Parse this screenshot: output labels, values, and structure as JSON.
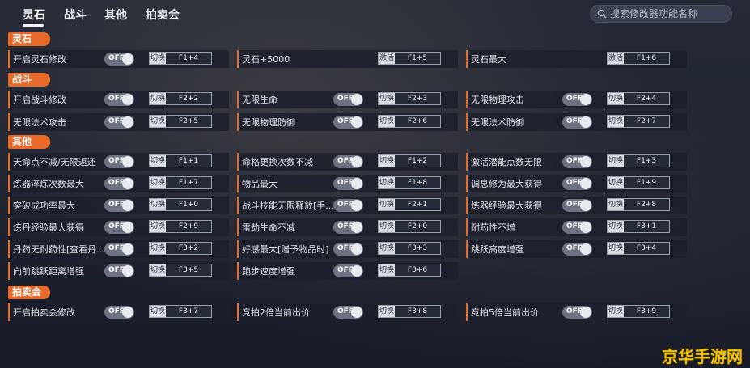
{
  "tabs": [
    {
      "label": "灵石"
    },
    {
      "label": "战斗"
    },
    {
      "label": "其他"
    },
    {
      "label": "拍卖会"
    }
  ],
  "search": {
    "placeholder": "搜索修改器功能名称"
  },
  "sections": [
    {
      "title": "灵石"
    },
    {
      "title": "战斗"
    },
    {
      "title": "其他"
    },
    {
      "title": "拍卖会"
    }
  ],
  "toggle_off_label": "OFF",
  "rows": [
    {
      "label": "开启灵石修改",
      "action": "切换",
      "key": "F1+4",
      "toggle": true
    },
    {
      "label": "灵石+5000",
      "action": "激活",
      "key": "F1+5",
      "toggle": false
    },
    {
      "label": "灵石最大",
      "action": "激活",
      "key": "F1+6",
      "toggle": false
    },
    {
      "label": "开启战斗修改",
      "action": "切换",
      "key": "F2+2",
      "toggle": true
    },
    {
      "label": "无限生命",
      "action": "切换",
      "key": "F2+3",
      "toggle": true
    },
    {
      "label": "无限物理攻击",
      "action": "切换",
      "key": "F2+4",
      "toggle": true
    },
    {
      "label": "无限法术攻击",
      "action": "切换",
      "key": "F2+5",
      "toggle": true
    },
    {
      "label": "无限物理防御",
      "action": "切换",
      "key": "F2+6",
      "toggle": true
    },
    {
      "label": "无限法术防御",
      "action": "切换",
      "key": "F2+7",
      "toggle": true
    },
    {
      "label": "天命点不减/无限返还",
      "action": "切换",
      "key": "F1+1",
      "toggle": true
    },
    {
      "label": "命格更换次数不减",
      "action": "切换",
      "key": "F1+2",
      "toggle": true
    },
    {
      "label": "激活潜能点数无限",
      "action": "切换",
      "key": "F1+3",
      "toggle": true
    },
    {
      "label": "炼器淬炼次数最大",
      "action": "切换",
      "key": "F1+7",
      "toggle": true
    },
    {
      "label": "物品最大",
      "action": "切换",
      "key": "F1+8",
      "toggle": true
    },
    {
      "label": "调息修为最大获得",
      "action": "切换",
      "key": "F1+9",
      "toggle": true
    },
    {
      "label": "突破成功率最大",
      "action": "切换",
      "key": "F1+0",
      "toggle": true
    },
    {
      "label": "战斗技能无限释放[手...",
      "action": "切换",
      "key": "F2+1",
      "toggle": true
    },
    {
      "label": "炼器经验最大获得",
      "action": "切换",
      "key": "F2+8",
      "toggle": true
    },
    {
      "label": "炼丹经验最大获得",
      "action": "切换",
      "key": "F2+9",
      "toggle": true
    },
    {
      "label": "雷劫生命不减",
      "action": "切换",
      "key": "F2+0",
      "toggle": true
    },
    {
      "label": "耐药性不增",
      "action": "切换",
      "key": "F3+1",
      "toggle": true
    },
    {
      "label": "丹药无耐药性[查看丹...",
      "action": "切换",
      "key": "F3+2",
      "toggle": true
    },
    {
      "label": "好感最大[赠予物品时]",
      "action": "切换",
      "key": "F3+3",
      "toggle": true
    },
    {
      "label": "跳跃高度增强",
      "action": "切换",
      "key": "F3+4",
      "toggle": true
    },
    {
      "label": "向前跳跃距离增强",
      "action": "切换",
      "key": "F3+5",
      "toggle": true
    },
    {
      "label": "跑步速度增强",
      "action": "切换",
      "key": "F3+6",
      "toggle": true
    },
    {
      "label": "开启拍卖会修改",
      "action": "切换",
      "key": "F3+7",
      "toggle": true
    },
    {
      "label": "竞拍2倍当前出价",
      "action": "切换",
      "key": "F3+8",
      "toggle": true
    },
    {
      "label": "竞拍5倍当前出价",
      "action": "切换",
      "key": "F3+9",
      "toggle": true
    }
  ],
  "watermark": "京华手游网",
  "colors": {
    "accent": "#e86a2a",
    "watermark": "#f3c400"
  }
}
